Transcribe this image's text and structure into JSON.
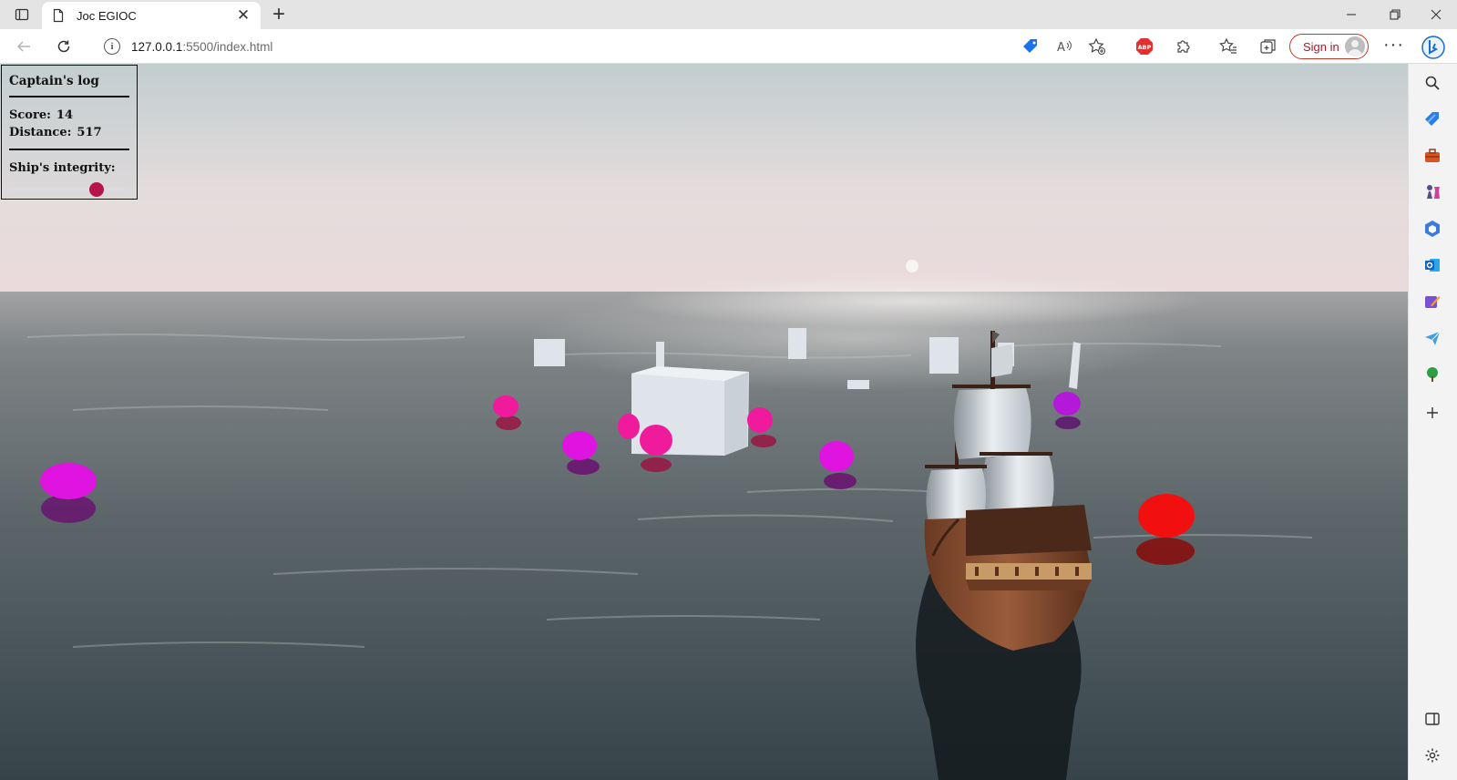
{
  "browser": {
    "tab_title": "Joc EGIOC",
    "url_host": "127.0.0.1",
    "url_path": ":5500/index.html",
    "signin_label": "Sign in"
  },
  "hud": {
    "title": "Captain's log",
    "score_label": "Score:",
    "score_value": "14",
    "distance_label": "Distance:",
    "distance_value": "517",
    "integrity_label": "Ship's integrity:",
    "integrity_fraction": 0.75,
    "integrity_color": "#b7144b"
  },
  "scene": {
    "sky_top": "#c3cdcf",
    "sky_horizon": "#e8d8da",
    "sea_far": "#8e9193",
    "sea_near": "#3e4a4f",
    "buoy_colors": {
      "magenta": "#e014e0",
      "pink": "#ef1a9c",
      "purple": "#b319d8",
      "red": "#f20f0f"
    },
    "obstacle_color": "#dfe4ea"
  },
  "sidebar_icons": [
    "search-icon",
    "tag-icon",
    "briefcase-icon",
    "chess-icon",
    "office-icon",
    "outlook-icon",
    "designer-icon",
    "send-icon",
    "tree-icon",
    "add-icon",
    "split-screen-icon",
    "settings-icon"
  ]
}
